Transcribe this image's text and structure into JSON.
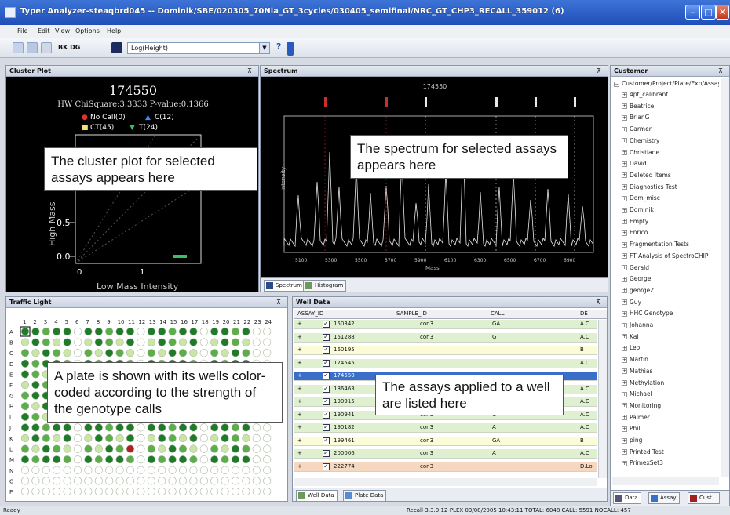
{
  "window": {
    "title": "Typer Analyzer-steaqbrd045 -- Dominik/SBE/020305_70Nia_GT_3cycles/030405_semifinal/NRC_GT_CHP3_RECALL_359012 (6)"
  },
  "menu": {
    "items": [
      "File",
      "Edit",
      "View",
      "Options",
      "Help"
    ]
  },
  "toolbar": {
    "plot_label_short": "BK DG",
    "combo_value": "Log(Height)",
    "help_glyph": "?"
  },
  "cluster_plot": {
    "header": "Cluster Plot",
    "assay_id": "174550",
    "stats": "HW ChiSquare:3.3333  P-value:0.1366",
    "legend": [
      {
        "label": "No Call(0)",
        "color": "#e03030",
        "shape": "circle"
      },
      {
        "label": "C(12)",
        "color": "#3a8cf0",
        "shape": "triangle"
      },
      {
        "label": "CT(45)",
        "color": "#f2e070",
        "shape": "square"
      },
      {
        "label": "T(24)",
        "color": "#3ac060",
        "shape": "triangle-down"
      }
    ],
    "ylabel": "High Mass",
    "xlabel": "Low Mass Intensity",
    "yticks": [
      "0.5",
      "0.0"
    ],
    "xticks": [
      "0",
      "1"
    ]
  },
  "spectrum": {
    "header": "Spectrum",
    "title": "174550",
    "ylabel": "Intensity",
    "xlabel": "Mass",
    "xticks": [
      "5100",
      "5300",
      "5500",
      "5700",
      "5900",
      "6100",
      "6300",
      "6500",
      "6700",
      "6900"
    ],
    "tabs": [
      "Spectrum",
      "Histogram"
    ]
  },
  "customer": {
    "header": "Customer",
    "root": "Customer/Project/Plate/Exp/Assay",
    "items": [
      "4pt_calibrant",
      "Beatrice",
      "BrianG",
      "Carmen",
      "Chemistry",
      "Christiane",
      "David",
      "Deleted Items",
      "Diagnostics Test",
      "Dom_misc",
      "Dominik",
      "Empty",
      "Enrico",
      "Fragmentation Tests",
      "FT Analysis of SpectroCHIP",
      "Gerald",
      "George",
      "georgeZ",
      "Guy",
      "HHC Genotype",
      "Johanna",
      "Kai",
      "Leo",
      "Martin",
      "Mathias",
      "Methylation",
      "Michael",
      "Monitoring",
      "Palmer",
      "Phil",
      "ping",
      "Printed Test",
      "PrimexSet3"
    ],
    "tabs": [
      "Data",
      "Assay",
      "Cust..."
    ]
  },
  "traffic_light": {
    "header": "Traffic Light",
    "columns": [
      "1",
      "2",
      "3",
      "4",
      "5",
      "6",
      "7",
      "8",
      "9",
      "10",
      "11",
      "12",
      "13",
      "14",
      "15",
      "16",
      "17",
      "18",
      "19",
      "20",
      "21",
      "22",
      "23",
      "24"
    ],
    "rows": [
      "A",
      "B",
      "C",
      "D",
      "E",
      "F",
      "G",
      "H",
      "I",
      "J",
      "K",
      "L",
      "M",
      "N",
      "O",
      "P"
    ],
    "colors": {
      "strong": "#1f7a2a",
      "medium": "#5cae4a",
      "weak": "#c9e6a6",
      "empty": "#ffffff",
      "selected": "#b02020"
    }
  },
  "well_data": {
    "header": "Well Data",
    "columns": [
      "ASSAY_ID",
      "SAMPLE_ID",
      "CALL",
      "DE"
    ],
    "rows": [
      {
        "id": "150342",
        "sample": "con3",
        "call": "GA",
        "de": "A.C",
        "color": "#dff0d0"
      },
      {
        "id": "151288",
        "sample": "con3",
        "call": "G",
        "de": "A.C",
        "color": "#dff0d0"
      },
      {
        "id": "160195",
        "sample": "",
        "call": "",
        "de": "B",
        "color": "#fbfbd8"
      },
      {
        "id": "174545",
        "sample": "",
        "call": "",
        "de": "A.C",
        "color": "#dff0d0"
      },
      {
        "id": "174550",
        "sample": "",
        "call": "",
        "de": "",
        "color": "#3a6ec8"
      },
      {
        "id": "186463",
        "sample": "",
        "call": "",
        "de": "A.C",
        "color": "#dff0d0"
      },
      {
        "id": "190915",
        "sample": "",
        "call": "",
        "de": "A.C",
        "color": "#dff0d0"
      },
      {
        "id": "190941",
        "sample": "con3",
        "call": "C",
        "de": "A.C",
        "color": "#dff0d0"
      },
      {
        "id": "190182",
        "sample": "con3",
        "call": "A",
        "de": "A.C",
        "color": "#dff0d0"
      },
      {
        "id": "199461",
        "sample": "con3",
        "call": "GA",
        "de": "B",
        "color": "#fbfbd8"
      },
      {
        "id": "200006",
        "sample": "con3",
        "call": "A",
        "de": "A.C",
        "color": "#dff0d0"
      },
      {
        "id": "222774",
        "sample": "con3",
        "call": "",
        "de": "D.Lo",
        "color": "#f6d8c0"
      }
    ],
    "tabs": [
      "Well Data",
      "Plate Data"
    ]
  },
  "status": {
    "left": "Ready",
    "right": "Recall-3.3.0.12-PLEX 03/08/2005 10:43:11  TOTAL: 6048  CALL: 5591  NOCALL: 457"
  },
  "callouts": {
    "cluster": "The cluster plot for selected assays appears here",
    "spectrum": "The spectrum for selected assays appears here",
    "plate": "A plate is shown with its wells color-coded according to the strength of the genotype calls",
    "welldata": "The assays applied to a well are listed here"
  }
}
